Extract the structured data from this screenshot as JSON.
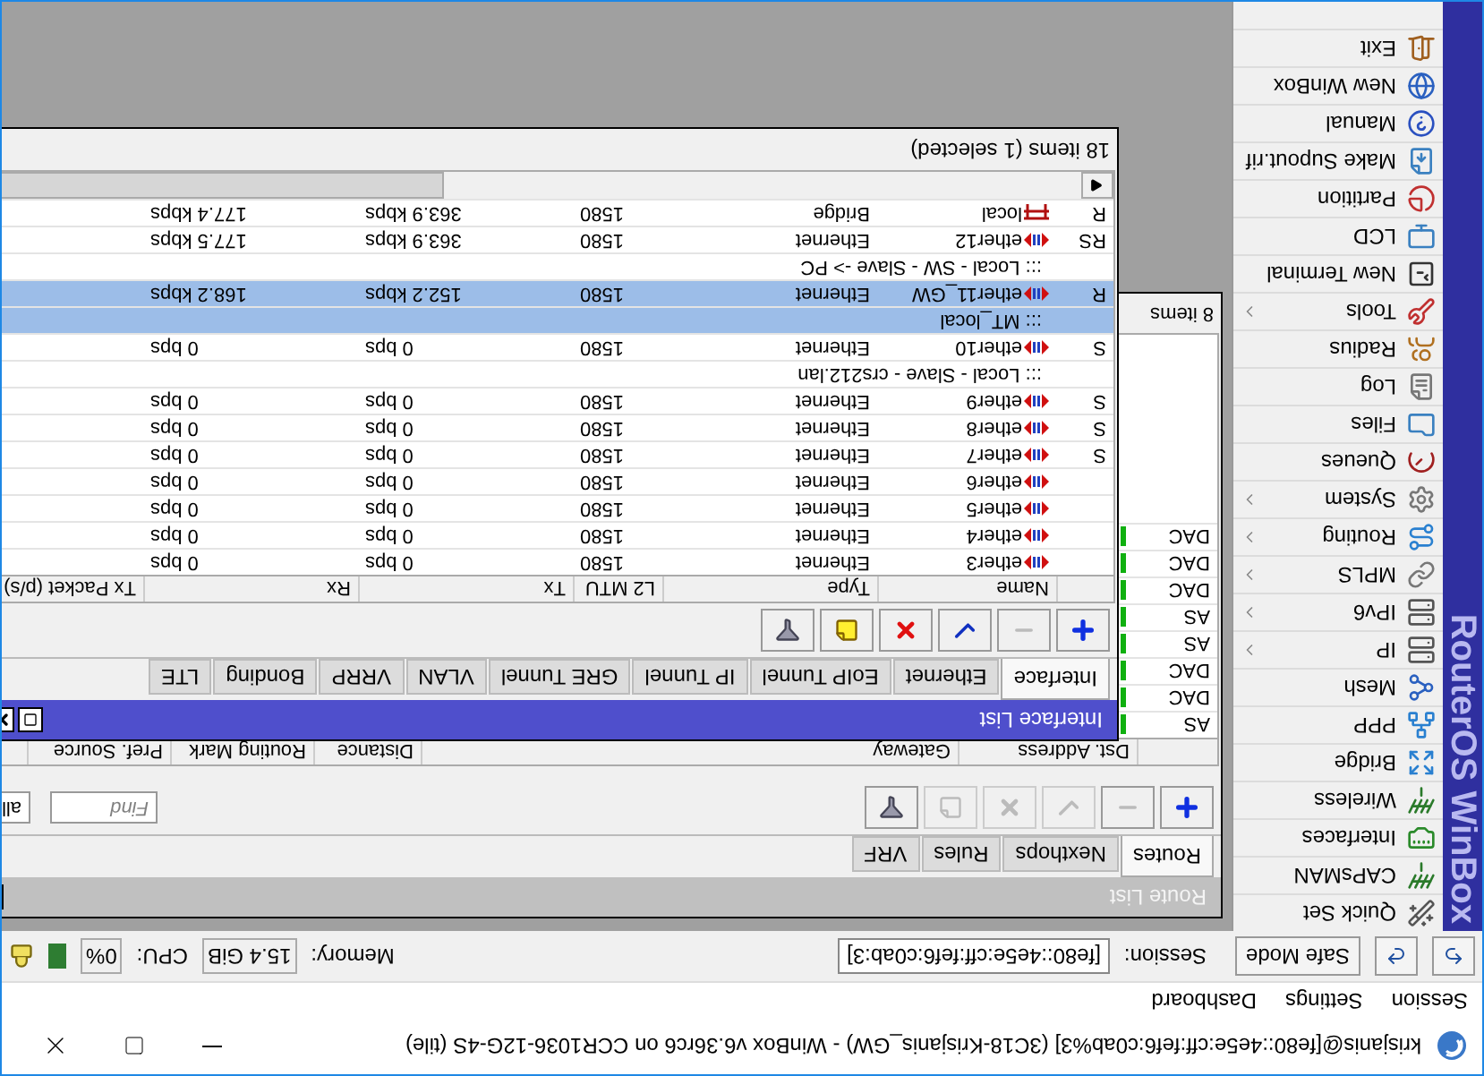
{
  "window": {
    "title": "krisjanis@[fe80::4e5e:cff:fef6:c0ab%3] (3C18-Krisjanis_GW) - WinBox v6.36rc6 on CCR1036-12G-4S (tile)"
  },
  "menu": [
    "Session",
    "Settings",
    "Dashboard"
  ],
  "toolbar": {
    "safe_mode": "Safe Mode",
    "session_label": "Session:",
    "session": "[fe80::4e5e:cff:fef6:c0ab:3]",
    "memory_label": "Memory:",
    "memory": "15.4 GiB",
    "cpu_label": "CPU:",
    "cpu": "0%"
  },
  "sidebar": {
    "brand": "RouterOS WinBox",
    "items": [
      {
        "label": "Quick Set",
        "submenu": false
      },
      {
        "label": "CAPsMAN",
        "submenu": false
      },
      {
        "label": "Interfaces",
        "submenu": false
      },
      {
        "label": "Wireless",
        "submenu": false
      },
      {
        "label": "Bridge",
        "submenu": false
      },
      {
        "label": "PPP",
        "submenu": false
      },
      {
        "label": "Mesh",
        "submenu": false
      },
      {
        "label": "IP",
        "submenu": true
      },
      {
        "label": "IPv6",
        "submenu": true
      },
      {
        "label": "MPLS",
        "submenu": true
      },
      {
        "label": "Routing",
        "submenu": true
      },
      {
        "label": "System",
        "submenu": true
      },
      {
        "label": "Queues",
        "submenu": false
      },
      {
        "label": "Files",
        "submenu": false
      },
      {
        "label": "Log",
        "submenu": false
      },
      {
        "label": "Radius",
        "submenu": false
      },
      {
        "label": "Tools",
        "submenu": true
      },
      {
        "label": "New Terminal",
        "submenu": false
      },
      {
        "label": "LCD",
        "submenu": false
      },
      {
        "label": "Partition",
        "submenu": false
      },
      {
        "label": "Make Supout.rif",
        "submenu": false
      },
      {
        "label": "Manual",
        "submenu": false
      },
      {
        "label": "New WinBox",
        "submenu": false
      },
      {
        "label": "Exit",
        "submenu": false
      }
    ]
  },
  "route_list": {
    "title": "Route List",
    "active": false,
    "tabs": [
      {
        "label": "Routes",
        "selected": true
      },
      {
        "label": "Nexthops",
        "selected": false
      },
      {
        "label": "Rules",
        "selected": false
      },
      {
        "label": "VRF",
        "selected": false
      }
    ],
    "buttons": [
      {
        "kind": "add",
        "disabled": false
      },
      {
        "kind": "remove",
        "disabled": false
      },
      {
        "kind": "enable",
        "disabled": true
      },
      {
        "kind": "disable",
        "disabled": true
      },
      {
        "kind": "comment",
        "disabled": true
      },
      {
        "kind": "filter",
        "disabled": false
      }
    ],
    "find": {
      "placeholder": "Find"
    },
    "filter": "all",
    "columns": [
      "Dst. Address",
      "Gateway",
      "Distance",
      "Routing Mark",
      "Pref. Source"
    ],
    "rows": [
      {
        "flags": "AS"
      },
      {
        "flags": "DAC"
      },
      {
        "flags": "DAC"
      },
      {
        "flags": "AS"
      },
      {
        "flags": "AS"
      },
      {
        "flags": "DAC"
      },
      {
        "flags": "DAC"
      },
      {
        "flags": "DAC"
      }
    ],
    "status": "8 items"
  },
  "interface_list": {
    "title": "Interface List",
    "active": true,
    "tabs": [
      {
        "label": "Interface",
        "selected": true
      },
      {
        "label": "Ethernet",
        "selected": false
      },
      {
        "label": "EoIP Tunnel",
        "selected": false
      },
      {
        "label": "IP Tunnel",
        "selected": false
      },
      {
        "label": "GRE Tunnel",
        "selected": false
      },
      {
        "label": "VLAN",
        "selected": false
      },
      {
        "label": "VRRP",
        "selected": false
      },
      {
        "label": "Bonding",
        "selected": false
      },
      {
        "label": "LTE",
        "selected": false
      }
    ],
    "buttons": [
      {
        "kind": "add",
        "disabled": false
      },
      {
        "kind": "remove",
        "disabled": false
      },
      {
        "kind": "enable",
        "disabled": false
      },
      {
        "kind": "disable",
        "disabled": false
      },
      {
        "kind": "comment",
        "disabled": false
      },
      {
        "kind": "filter",
        "disabled": false
      }
    ],
    "columns": [
      "Name",
      "Type",
      "L2 MTU",
      "Tx",
      "Rx",
      "Tx Packet (p/s)"
    ],
    "rows": [
      {
        "kind": "ethernet",
        "flags": "",
        "name": "ether3",
        "type": "Ethernet",
        "l2mtu": "1580",
        "tx": "0 bps",
        "rx": "0 bps",
        "selected": false
      },
      {
        "kind": "ethernet",
        "flags": "",
        "name": "ether4",
        "type": "Ethernet",
        "l2mtu": "1580",
        "tx": "0 bps",
        "rx": "0 bps",
        "selected": false
      },
      {
        "kind": "ethernet",
        "flags": "",
        "name": "ether5",
        "type": "Ethernet",
        "l2mtu": "1580",
        "tx": "0 bps",
        "rx": "0 bps",
        "selected": false
      },
      {
        "kind": "ethernet",
        "flags": "",
        "name": "ether6",
        "type": "Ethernet",
        "l2mtu": "1580",
        "tx": "0 bps",
        "rx": "0 bps",
        "selected": false
      },
      {
        "kind": "ethernet",
        "flags": "S",
        "name": "ether7",
        "type": "Ethernet",
        "l2mtu": "1580",
        "tx": "0 bps",
        "rx": "0 bps",
        "selected": false
      },
      {
        "kind": "ethernet",
        "flags": "S",
        "name": "ether8",
        "type": "Ethernet",
        "l2mtu": "1580",
        "tx": "0 bps",
        "rx": "0 bps",
        "selected": false
      },
      {
        "kind": "ethernet",
        "flags": "S",
        "name": "ether9",
        "type": "Ethernet",
        "l2mtu": "1580",
        "tx": "0 bps",
        "rx": "0 bps",
        "selected": false
      },
      {
        "kind": "comment",
        "text": "::: Local - Slave - crs212.lan",
        "selected": false
      },
      {
        "kind": "ethernet",
        "flags": "S",
        "name": "ether10",
        "type": "Ethernet",
        "l2mtu": "1580",
        "tx": "0 bps",
        "rx": "0 bps",
        "selected": false
      },
      {
        "kind": "comment",
        "text": "::: MT_local",
        "selected": true
      },
      {
        "kind": "ethernet",
        "flags": "R",
        "name": "ether11_GW",
        "type": "Ethernet",
        "l2mtu": "1580",
        "tx": "152.2 kbps",
        "rx": "168.2 kbps",
        "selected": true
      },
      {
        "kind": "comment",
        "text": "::: Local - SW - Slave -> PC",
        "selected": false
      },
      {
        "kind": "ethernet",
        "flags": "RS",
        "name": "ether12",
        "type": "Ethernet",
        "l2mtu": "1580",
        "tx": "363.9 kbps",
        "rx": "177.5 kbps",
        "selected": false
      },
      {
        "kind": "bridge",
        "flags": "R",
        "name": "local",
        "type": "Bridge",
        "l2mtu": "1580",
        "tx": "363.9 kbps",
        "rx": "177.4 kbps",
        "selected": false
      }
    ],
    "status": "18 items (1 selected)"
  }
}
